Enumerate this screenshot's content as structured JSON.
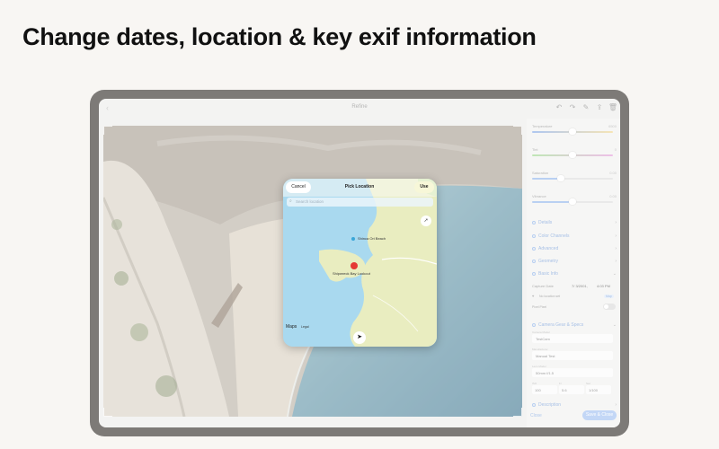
{
  "headline": "Change dates, location & key exif information",
  "app": {
    "title": "Refine",
    "toolbar_icons": [
      "back-icon",
      "undo-icon",
      "redo-icon",
      "markup-icon",
      "share-icon",
      "trash-icon"
    ]
  },
  "sliders": [
    {
      "label": "Temperature",
      "value": "6500",
      "fill": 0.5
    },
    {
      "label": "Tint",
      "value": "0",
      "fill": 0.5
    },
    {
      "label": "Saturation",
      "value": "0.00",
      "fill": 0.35
    },
    {
      "label": "Vibrance",
      "value": "0.00",
      "fill": 0.5
    }
  ],
  "sections": [
    "Details",
    "Color Channels",
    "Advanced",
    "Geometry",
    "Basic Info"
  ],
  "basic_info": {
    "capture_date_label": "Capture Date",
    "capture_date": "7/ 3/2001,",
    "capture_time": "4:03 PM",
    "location_label": "No location set",
    "location_btn": "Map",
    "pixel_pixel_label": "Pixel Pixel"
  },
  "camera": {
    "section_label": "Camera Gear & Specs",
    "camera_model_label": "Camera Model",
    "camera_model": "TestCam",
    "manufacturer_label": "Manufacturer",
    "manufacturer": "Manual Test",
    "lens_label": "Lens Model",
    "lens": "50mm f/1.5",
    "iso_label": "ISO",
    "iso": "100",
    "fnum_label": "F/",
    "fnum": "5.6",
    "shutter_label": "Sec",
    "shutter": "1/100"
  },
  "description_label": "Description",
  "close_label": "Close",
  "save_label": "Save & Close",
  "dialog": {
    "cancel": "Cancel",
    "title": "Pick Location",
    "use": "Use",
    "search_placeholder": "Search location",
    "poi_beach": "Shinca Ori Beach",
    "poi_lookout": "Shipwreck Bay Lookout",
    "maps_brand": "Maps",
    "legal": "Legal"
  },
  "colors": {
    "accent": "#6f98d6",
    "water": "#a9d9ef",
    "land": "#e9edc0",
    "pin": "#e53935"
  }
}
